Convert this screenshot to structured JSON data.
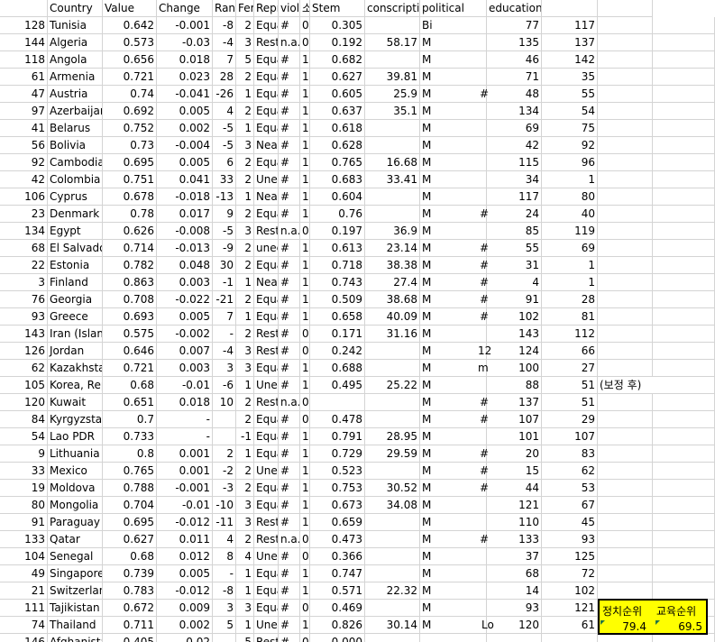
{
  "headers": [
    "",
    "Country",
    "Value",
    "Change",
    "Rank",
    "Fert",
    "Repr",
    "violen",
    "소득격차",
    "Stem",
    "conscription",
    "political",
    "educational",
    "",
    ""
  ],
  "rows": [
    [
      "128",
      "Tunisia",
      "0.642",
      "-0.001",
      "-8",
      "2",
      "Equa",
      "#",
      "0",
      "0.305",
      "",
      "Bi",
      "",
      "77",
      "117",
      "",
      ""
    ],
    [
      "144",
      "Algeria",
      "0.573",
      "-0.03",
      "-4",
      "3",
      "Restr",
      "n.a.",
      "0",
      "0.192",
      "58.17",
      "M",
      "",
      "135",
      "137",
      "",
      ""
    ],
    [
      "118",
      "Angola",
      "0.656",
      "0.018",
      "7",
      "5",
      "Equa",
      "#",
      "1",
      "0.682",
      "",
      "M",
      "",
      "46",
      "142",
      "",
      ""
    ],
    [
      "61",
      "Armenia",
      "0.721",
      "0.023",
      "28",
      "2",
      "Equa",
      "#",
      "1",
      "0.627",
      "39.81",
      "M",
      "",
      "71",
      "35",
      "",
      ""
    ],
    [
      "47",
      "Austria",
      "0.74",
      "-0.041",
      "-26",
      "1",
      "Equa",
      "#",
      "1",
      "0.605",
      "25.9",
      "M",
      "#",
      "48",
      "55",
      "",
      ""
    ],
    [
      "97",
      "Azerbaijan",
      "0.692",
      "0.005",
      "4",
      "2",
      "Equa",
      "#",
      "1",
      "0.637",
      "35.1",
      "M",
      "",
      "134",
      "54",
      "",
      ""
    ],
    [
      "41",
      "Belarus",
      "0.752",
      "0.002",
      "-5",
      "1",
      "Equa",
      "#",
      "1",
      "0.618",
      "",
      "M",
      "",
      "69",
      "75",
      "",
      ""
    ],
    [
      "56",
      "Bolivia",
      "0.73",
      "-0.004",
      "-5",
      "3",
      "Near",
      "#",
      "1",
      "0.628",
      "",
      "M",
      "",
      "42",
      "92",
      "",
      ""
    ],
    [
      "92",
      "Cambodia",
      "0.695",
      "0.005",
      "6",
      "2",
      "Equa",
      "#",
      "1",
      "0.765",
      "16.68",
      "M",
      "",
      "115",
      "96",
      "",
      ""
    ],
    [
      "42",
      "Colombia",
      "0.751",
      "0.041",
      "33",
      "2",
      "Unev",
      "#",
      "1",
      "0.683",
      "33.41",
      "M",
      "",
      "34",
      "1",
      "",
      ""
    ],
    [
      "106",
      "Cyprus",
      "0.678",
      "-0.018",
      "-13",
      "1",
      "Near",
      "#",
      "1",
      "0.604",
      "",
      "M",
      "",
      "117",
      "80",
      "",
      ""
    ],
    [
      "23",
      "Denmark",
      "0.78",
      "0.017",
      "9",
      "2",
      "Equa",
      "#",
      "1",
      "0.76",
      "",
      "M",
      "#",
      "24",
      "40",
      "",
      ""
    ],
    [
      "134",
      "Egypt",
      "0.626",
      "-0.008",
      "-5",
      "3",
      "Restr",
      "n.a.",
      "0",
      "0.197",
      "36.9",
      "M",
      "",
      "85",
      "119",
      "",
      ""
    ],
    [
      "68",
      "El Salvador",
      "0.714",
      "-0.013",
      "-9",
      "2",
      "unec",
      "#",
      "1",
      "0.613",
      "23.14",
      "M",
      "#",
      "55",
      "69",
      "",
      ""
    ],
    [
      "22",
      "Estonia",
      "0.782",
      "0.048",
      "30",
      "2",
      "Equa",
      "#",
      "1",
      "0.718",
      "38.38",
      "M",
      "#",
      "31",
      "1",
      "",
      ""
    ],
    [
      "3",
      "Finland",
      "0.863",
      "0.003",
      "-1",
      "1",
      "Near",
      "#",
      "1",
      "0.743",
      "27.4",
      "M",
      "#",
      "4",
      "1",
      "",
      ""
    ],
    [
      "76",
      "Georgia",
      "0.708",
      "-0.022",
      "-21",
      "2",
      "Equa",
      "#",
      "1",
      "0.509",
      "38.68",
      "M",
      "#",
      "91",
      "28",
      "",
      ""
    ],
    [
      "93",
      "Greece",
      "0.693",
      "0.005",
      "7",
      "1",
      "Equa",
      "#",
      "1",
      "0.658",
      "40.09",
      "M",
      "#",
      "102",
      "81",
      "",
      ""
    ],
    [
      "143",
      "Iran (Islamic",
      "0.575",
      "-0.002",
      "-",
      "2",
      "Restr",
      "#",
      "0",
      "0.171",
      "31.16",
      "M",
      "",
      "143",
      "112",
      "",
      ""
    ],
    [
      "126",
      "Jordan",
      "0.646",
      "0.007",
      "-4",
      "3",
      "Restr",
      "#",
      "0",
      "0.242",
      "",
      "M",
      "12",
      "124",
      "66",
      "",
      ""
    ],
    [
      "62",
      "Kazakhstan",
      "0.721",
      "0.003",
      "3",
      "3",
      "Equa",
      "#",
      "1",
      "0.688",
      "",
      "M",
      "m",
      "100",
      "27",
      "",
      ""
    ],
    [
      "105",
      "Korea, Rep",
      "0.68",
      "-0.01",
      "-6",
      "1",
      "Unev",
      "#",
      "1",
      "0.495",
      "25.22",
      "M",
      "",
      "88",
      "51",
      "(보정 후)",
      ""
    ],
    [
      "120",
      "Kuwait",
      "0.651",
      "0.018",
      "10",
      "2",
      "Restr",
      "n.a.",
      "0",
      "",
      "",
      "M",
      "#",
      "137",
      "51",
      "",
      ""
    ],
    [
      "84",
      "Kyrgyzstan",
      "0.7",
      "-",
      "",
      "2",
      "Equa",
      "#",
      "0",
      "0.478",
      "",
      "M",
      "#",
      "107",
      "29",
      "",
      ""
    ],
    [
      "54",
      "Lao PDR",
      "0.733",
      "-",
      "",
      "-1",
      "Equa",
      "#",
      "1",
      "0.791",
      "28.95",
      "M",
      "",
      "101",
      "107",
      "",
      ""
    ],
    [
      "9",
      "Lithuania",
      "0.8",
      "0.001",
      "2",
      "1",
      "Equa",
      "#",
      "1",
      "0.729",
      "29.59",
      "M",
      "#",
      "20",
      "83",
      "",
      ""
    ],
    [
      "33",
      "Mexico",
      "0.765",
      "0.001",
      "-2",
      "2",
      "Unev",
      "#",
      "1",
      "0.523",
      "",
      "M",
      "#",
      "15",
      "62",
      "",
      ""
    ],
    [
      "19",
      "Moldova",
      "0.788",
      "-0.001",
      "-3",
      "2",
      "Equa",
      "#",
      "1",
      "0.753",
      "30.52",
      "M",
      "#",
      "44",
      "53",
      "",
      ""
    ],
    [
      "80",
      "Mongolia",
      "0.704",
      "-0.01",
      "-10",
      "3",
      "Equa",
      "#",
      "1",
      "0.673",
      "34.08",
      "M",
      "",
      "121",
      "67",
      "",
      ""
    ],
    [
      "91",
      "Paraguay",
      "0.695",
      "-0.012",
      "-11",
      "3",
      "Restr",
      "#",
      "1",
      "0.659",
      "",
      "M",
      "",
      "110",
      "45",
      "",
      ""
    ],
    [
      "133",
      "Qatar",
      "0.627",
      "0.011",
      "4",
      "2",
      "Restr",
      "n.a.",
      "0",
      "0.473",
      "",
      "M",
      "#",
      "133",
      "93",
      "",
      ""
    ],
    [
      "104",
      "Senegal",
      "0.68",
      "0.012",
      "8",
      "4",
      "Unec",
      "#",
      "0",
      "0.366",
      "",
      "M",
      "",
      "37",
      "125",
      "",
      ""
    ],
    [
      "49",
      "Singapore",
      "0.739",
      "0.005",
      "-",
      "1",
      "Equa",
      "#",
      "1",
      "0.747",
      "",
      "M",
      "",
      "68",
      "72",
      "",
      ""
    ],
    [
      "21",
      "Switzerland",
      "0.783",
      "-0.012",
      "-8",
      "1",
      "Equa",
      "#",
      "1",
      "0.571",
      "22.32",
      "M",
      "",
      "14",
      "102",
      "",
      ""
    ],
    [
      "111",
      "Tajikistan",
      "0.672",
      "0.009",
      "3",
      "3",
      "Equa",
      "#",
      "0",
      "0.469",
      "",
      "M",
      "",
      "93",
      "121",
      "",
      ""
    ],
    [
      "74",
      "Thailand",
      "0.711",
      "0.002",
      "5",
      "1",
      "Unev",
      "#",
      "1",
      "0.826",
      "30.14",
      "M",
      "Lo",
      "120",
      "61",
      "",
      ""
    ],
    [
      "146",
      "Afghanistan",
      "0.405",
      "0.02",
      "",
      "5",
      "Restr",
      "#",
      "0",
      "0.000",
      "",
      "",
      "",
      "",
      "",
      "",
      ""
    ]
  ],
  "summary": {
    "political_label": "정치순위",
    "educational_label": "교육순위",
    "political_value": "79.4",
    "educational_value": "69.5"
  },
  "colors": {
    "highlight": "#ffff00",
    "gridline": "#d4d4d4",
    "marker": "#217346"
  }
}
